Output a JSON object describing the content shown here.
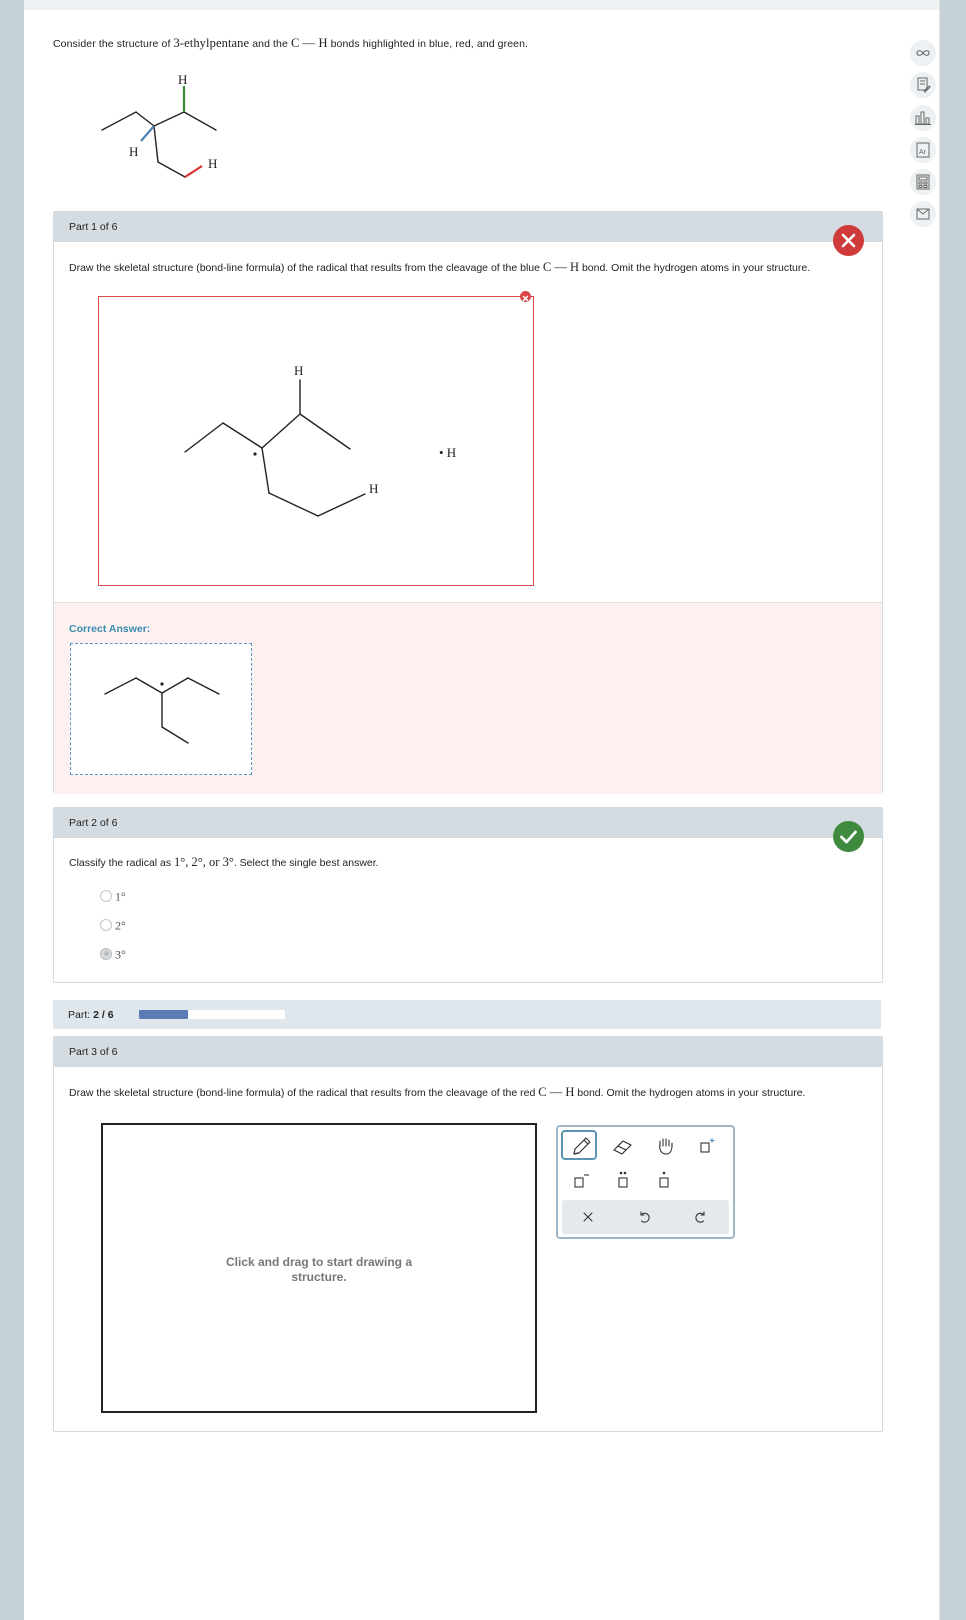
{
  "intro": {
    "text_prefix": "Consider the structure of ",
    "compound": "3-ethylpentane",
    "text_middle": " and the ",
    "bond": "C — H",
    "text_suffix": " bonds highlighted in blue, red, and green."
  },
  "structure_labels": {
    "h": "H"
  },
  "part1": {
    "header": "Part 1 of 6",
    "status": "incorrect",
    "q_prefix": "Draw the skeletal structure (bond-line formula) of the radical that results from the cleavage of the blue ",
    "q_bond": "C — H",
    "q_suffix": " bond. Omit the hydrogen atoms in your structure.",
    "answer_labels": {
      "h_top": "H",
      "h_lower": "H",
      "h_radical": "• H"
    },
    "correct_answer_label": "Correct Answer:"
  },
  "part2": {
    "header": "Part 2 of 6",
    "status": "correct",
    "q_prefix": "Classify the radical as ",
    "q_options_inline": "1°, 2°, or 3°",
    "q_suffix": ". Select the single best answer.",
    "options": [
      {
        "label": "1°",
        "selected": false
      },
      {
        "label": "2°",
        "selected": false
      },
      {
        "label": "3°",
        "selected": true
      }
    ]
  },
  "progress": {
    "label": "Part:",
    "value": "2 / 6",
    "fraction": 0.333
  },
  "part3": {
    "header": "Part 3 of 6",
    "q_prefix": "Draw the skeletal structure (bond-line formula) of the radical that results from the cleavage of the red ",
    "q_bond": "C — H",
    "q_suffix": " bond. Omit the hydrogen atoms in your structure.",
    "placeholder": "Click and drag to start drawing a structure."
  },
  "toolbar": {
    "tools": [
      "pencil-icon",
      "eraser-icon",
      "hand-icon",
      "add-charge-icon",
      "negative-charge-icon",
      "lone-pair-icon",
      "radical-icon"
    ],
    "actions": [
      "clear-icon",
      "undo-icon",
      "redo-icon"
    ]
  },
  "side_tools": [
    "infinity-icon",
    "notepad-icon",
    "chart-icon",
    "dictionary-icon",
    "calculator-icon",
    "mail-icon"
  ],
  "colors": {
    "blue_bond": "#4a7fb5",
    "red_bond": "#d83030",
    "green_bond": "#3a8a3a",
    "wrong": "#cf3a3a",
    "correct": "#3f8a3f",
    "progress": "#5a7bb3"
  }
}
